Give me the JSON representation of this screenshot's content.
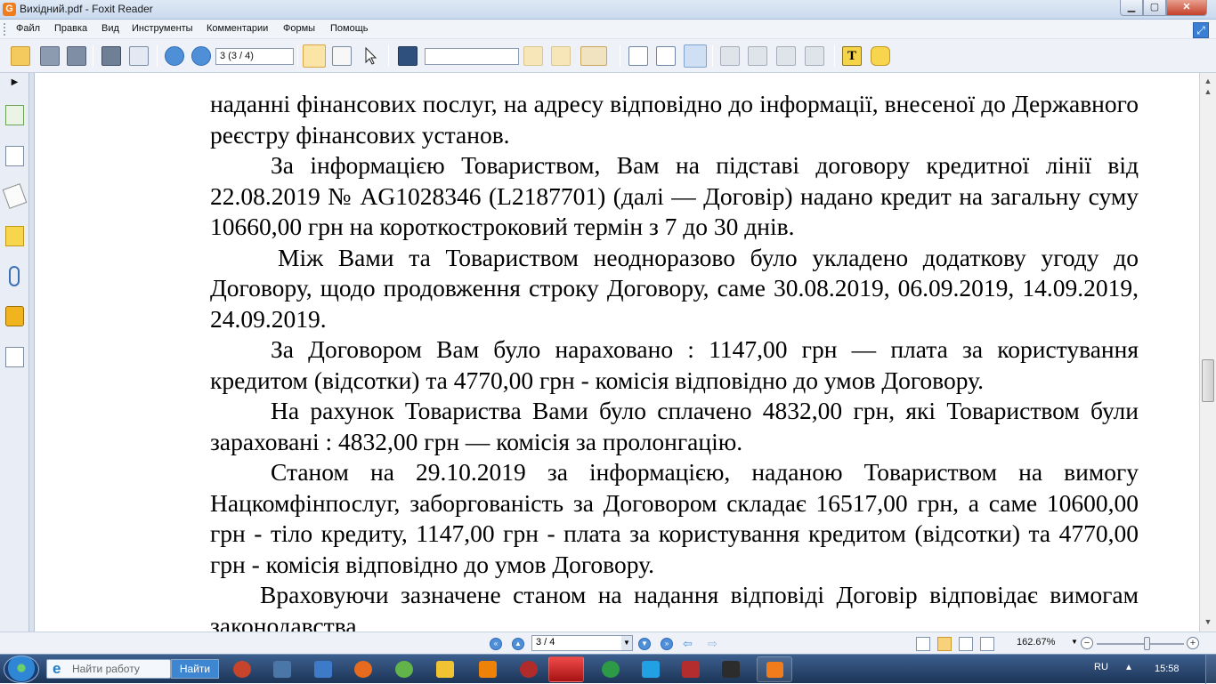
{
  "window": {
    "title": "Вихідний.pdf - Foxit Reader",
    "app_icon": "G",
    "controls": {
      "minimize": "▁",
      "maximize": "▢",
      "close": "✕"
    }
  },
  "menu": {
    "items": [
      "Файл",
      "Правка",
      "Вид",
      "Инструменты",
      "Комментарии",
      "Формы",
      "Помощь"
    ]
  },
  "toolbar": {
    "page_value": "3 (3 / 4)",
    "search_value": "",
    "icons": [
      "open-icon",
      "save-icon",
      "save-all-icon",
      "print-icon",
      "email-icon",
      "prev-page-icon",
      "next-page-icon",
      "hand-tool-icon",
      "select-text-icon",
      "select-icon",
      "find-icon",
      "find-prev-icon",
      "find-next-icon",
      "highlight-icon",
      "actual-size-icon",
      "fit-page-icon",
      "fit-width-icon",
      "pdf-create-icon",
      "pdf-convert-icon",
      "pdf-edit-icon",
      "pdf-tools-icon",
      "typewriter-icon",
      "note-icon"
    ]
  },
  "document": {
    "paragraphs": [
      {
        "style": "cont",
        "text": "наданні фінансових послуг, на адресу відповідно до інформації, внесеної до Державного реєстру фінансових установ."
      },
      {
        "style": "ind",
        "text": "За інформацією Товариством, Вам на підставі договору кредитної лінії від 22.08.2019 № AG1028346 (L2187701) (далі — Договір) надано кредит на загальну суму 10660,00 грн на короткостроковий термін з 7 до 30 днів."
      },
      {
        "style": "ind2",
        "text": "Між Вами та Товариством  неодноразово  було укладено додаткову угоду до Договору, щодо продовження строку Договору, саме 30.08.2019, 06.09.2019, 14.09.2019, 24.09.2019."
      },
      {
        "style": "ind",
        "text": "За Договором Вам було нараховано : 1147,00 грн — плата за користування кредитом (відсотки) та 4770,00 грн -  комісія відповідно до умов Договору."
      },
      {
        "style": "ind",
        "text": "На рахунок Товариства Вами було сплачено 4832,00 грн, які Товариством були зараховані : 4832,00 грн — комісія за пролонгацію."
      },
      {
        "style": "ind",
        "text": "Станом на 29.10.2019 за інформацією, наданою Товариством на вимогу Нацкомфінпослуг,  заборгованість за Договором складає 16517,00 грн, а саме 10600,00  грн - тіло кредиту, 1147,00 грн - плата за користування кредитом (відсотки) та 4770,00 грн  - комісія відповідно до умов Договору."
      },
      {
        "style": "ind3",
        "text": "Враховуючи зазначене станом на надання відповіді Договір відповідає вимогам законодавства."
      }
    ]
  },
  "statusbar": {
    "page_value": "3 / 4",
    "zoom": "162.67%",
    "zoom_minus": "−",
    "zoom_plus": "+"
  },
  "taskbar": {
    "search_placeholder": "Найти работу",
    "search_button": "Найти",
    "language": "RU",
    "clock": "15:58",
    "tray_arrow": "▲"
  },
  "colors": {
    "accent": "#3d86d2",
    "taskbar": "#1d3557",
    "close_button": "#c4412a"
  }
}
